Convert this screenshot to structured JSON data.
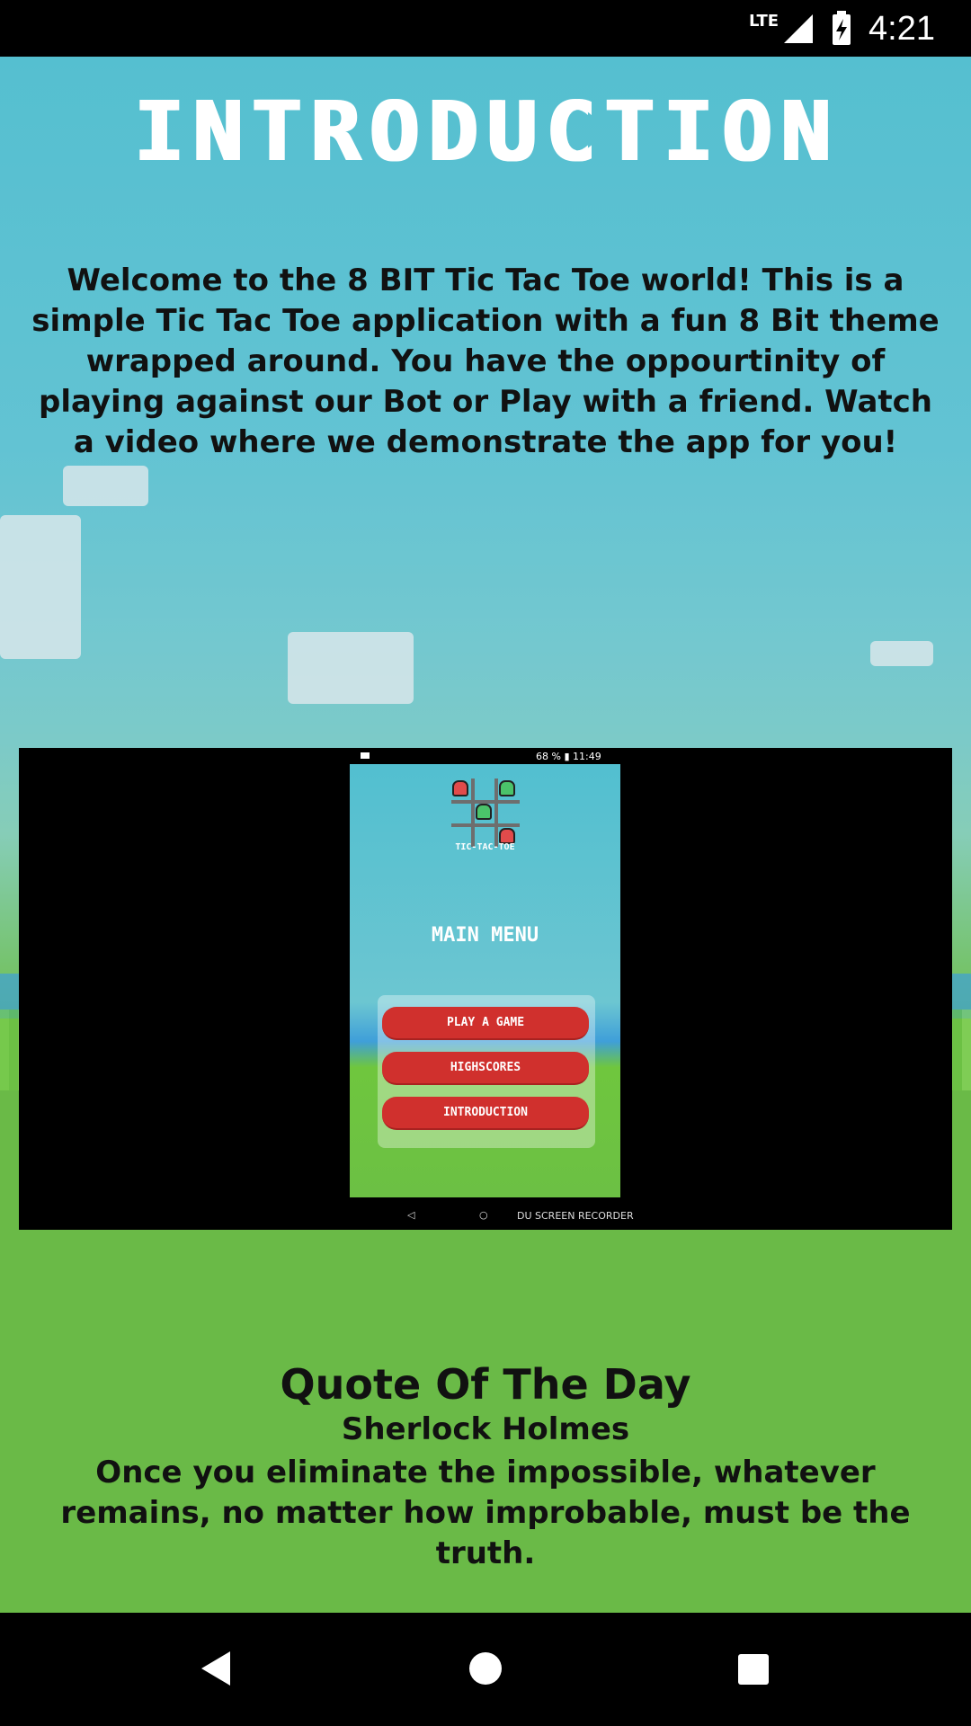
{
  "status_bar": {
    "network": "LTE",
    "time": "4:21"
  },
  "page": {
    "title": "INTRODUCTION",
    "intro_text": "Welcome to the 8 BIT Tic Tac Toe world! This is a simple Tic Tac Toe application with a fun 8 Bit theme wrapped around. You have the oppourtinity of playing against our Bot or Play with a friend. Watch a video where we demonstrate the app for you!"
  },
  "video": {
    "status_text": "68 % ▮ 11:49",
    "logo_text": "TIC-TAC-TOE",
    "menu_title": "MAIN MENU",
    "buttons": [
      "PLAY A GAME",
      "HIGHSCORES",
      "INTRODUCTION"
    ],
    "recorder_label": "DU SCREEN RECORDER"
  },
  "quote": {
    "heading": "Quote Of The Day",
    "author": "Sherlock Holmes",
    "text": "Once you eliminate the impossible, whatever remains, no matter how improbable, must be the truth."
  },
  "colors": {
    "sky": "#55bfd0",
    "grass": "#6aba47",
    "button_red": "#d0302d"
  },
  "nav_bar": {
    "icons": [
      "back-icon",
      "home-icon",
      "recents-icon"
    ]
  }
}
